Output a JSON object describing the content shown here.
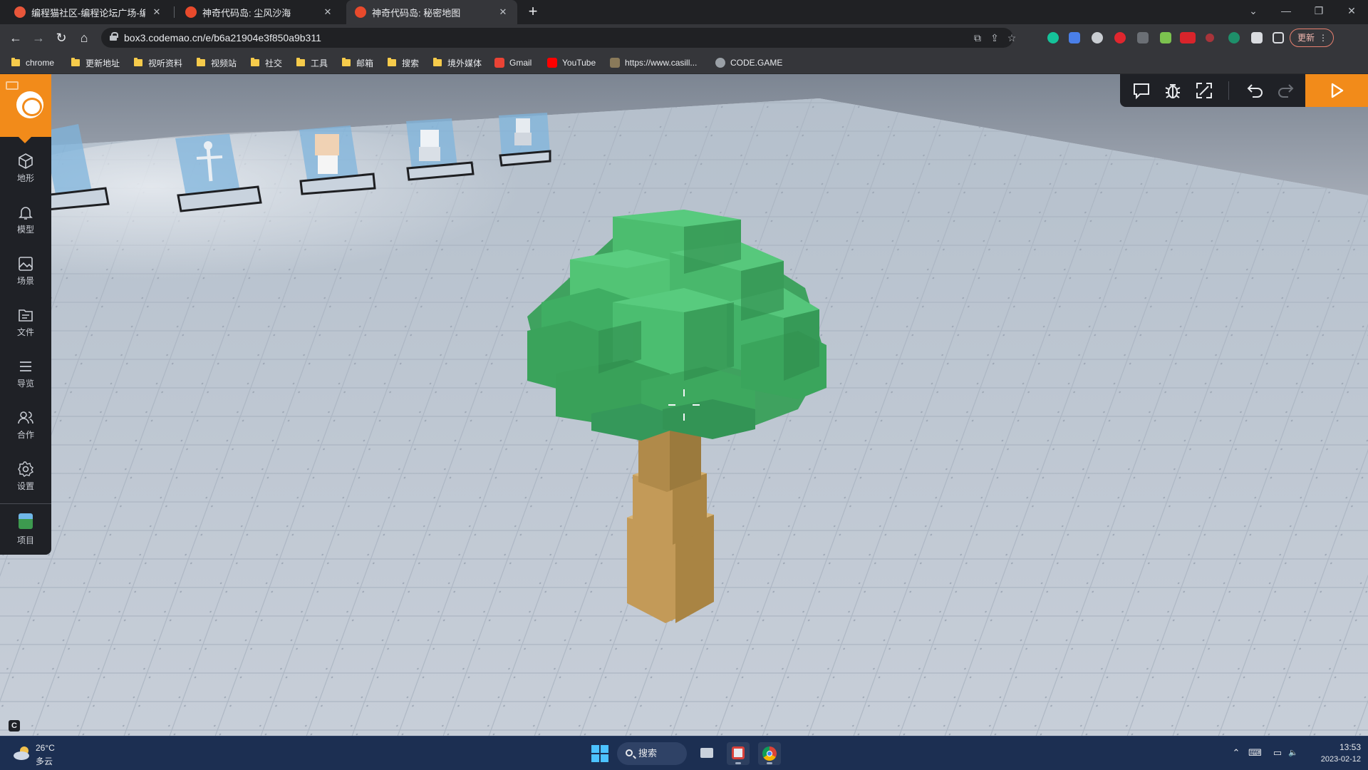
{
  "browser": {
    "tabs": [
      {
        "title": "编程猫社区-编程论坛广场-编程学",
        "close": "✕",
        "active": false
      },
      {
        "title": "神奇代码岛: 尘风沙海",
        "close": "✕",
        "active": false
      },
      {
        "title": "神奇代码岛: 秘密地图",
        "close": "✕",
        "active": true
      }
    ],
    "new_tab": "+",
    "window_controls": {
      "dropdown": "⌄",
      "minimize": "—",
      "restore": "❐",
      "close": "✕"
    },
    "nav": {
      "back": "←",
      "forward": "→",
      "reload": "↻",
      "home": "⌂"
    },
    "url": "box3.codemao.cn/e/b6a21904e3f850a9b311",
    "omnibox_icons": {
      "open_external": "⧉",
      "share": "⇪",
      "bookmark_star": "☆"
    },
    "update_button": "更新",
    "menu": "⋮",
    "bookmarks": [
      {
        "label": "chrome",
        "kind": "folder"
      },
      {
        "label": "更新地址",
        "kind": "folder"
      },
      {
        "label": "视听资料",
        "kind": "folder"
      },
      {
        "label": "视频站",
        "kind": "folder"
      },
      {
        "label": "社交",
        "kind": "folder"
      },
      {
        "label": "工具",
        "kind": "folder"
      },
      {
        "label": "邮箱",
        "kind": "folder"
      },
      {
        "label": "搜索",
        "kind": "folder"
      },
      {
        "label": "境外媒体",
        "kind": "folder"
      },
      {
        "label": "Gmail",
        "kind": "site",
        "color": "#ea4335"
      },
      {
        "label": "YouTube",
        "kind": "site",
        "color": "#ff0000"
      },
      {
        "label": "https://www.casill...",
        "kind": "site",
        "color": "#8a7a5a"
      },
      {
        "label": "CODE.GAME",
        "kind": "site",
        "color": "#9aa0a6"
      }
    ]
  },
  "editor": {
    "side_items": [
      {
        "label": "地形",
        "icon": "cube-icon"
      },
      {
        "label": "模型",
        "icon": "bell-model-icon"
      },
      {
        "label": "场景",
        "icon": "image-icon"
      },
      {
        "label": "文件",
        "icon": "folder-icon"
      },
      {
        "label": "导览",
        "icon": "list-icon"
      },
      {
        "label": "合作",
        "icon": "users-icon"
      },
      {
        "label": "设置",
        "icon": "gear-icon"
      },
      {
        "label": "项目",
        "icon": "project-thumbnail"
      }
    ],
    "corner_badge": "C",
    "accent": "#f28b1a",
    "panel_color": "#1f2126"
  },
  "taskbar": {
    "weather_temp": "26°C",
    "weather_desc": "多云",
    "search_label": "搜索",
    "time": "13:53",
    "date": "2023-02-12",
    "tray_icons": {
      "chevron": "⌃",
      "keyboard": "⌨",
      "network": "▭",
      "volume": "🔈"
    }
  }
}
